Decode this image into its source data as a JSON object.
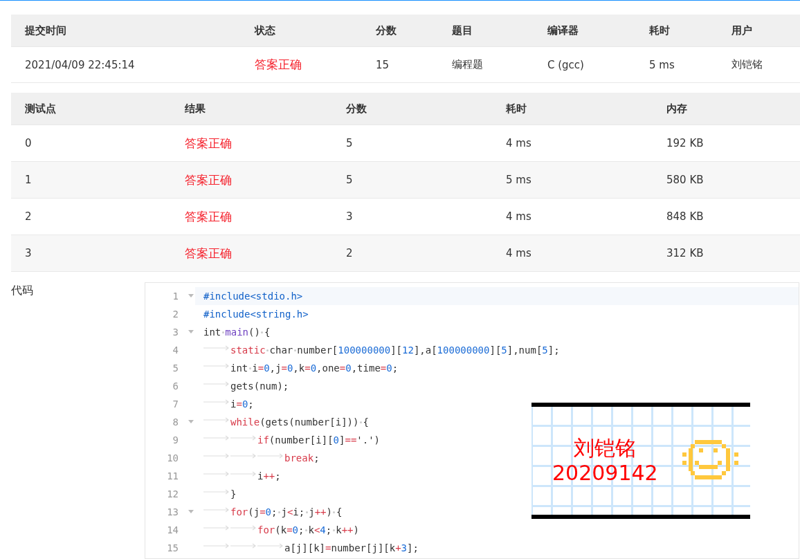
{
  "submission": {
    "columns": [
      "提交时间",
      "状态",
      "分数",
      "题目",
      "编译器",
      "耗时",
      "用户"
    ],
    "row": [
      {
        "kind": "plain",
        "text": "2021/04/09 22:45:14"
      },
      {
        "kind": "accepted",
        "text": "答案正确"
      },
      {
        "kind": "plain",
        "text": "15"
      },
      {
        "kind": "plain",
        "text": "编程题"
      },
      {
        "kind": "plain",
        "text": "C (gcc)"
      },
      {
        "kind": "plain",
        "text": "5 ms"
      },
      {
        "kind": "plain",
        "text": "刘铠铭"
      }
    ]
  },
  "tests": {
    "columns": [
      "测试点",
      "结果",
      "分数",
      "耗时",
      "内存"
    ],
    "rows": [
      [
        {
          "kind": "plain",
          "text": "0"
        },
        {
          "kind": "accepted",
          "text": "答案正确"
        },
        {
          "kind": "plain",
          "text": "5"
        },
        {
          "kind": "plain",
          "text": "4 ms"
        },
        {
          "kind": "plain",
          "text": "192 KB"
        }
      ],
      [
        {
          "kind": "plain",
          "text": "1"
        },
        {
          "kind": "accepted",
          "text": "答案正确"
        },
        {
          "kind": "plain",
          "text": "5"
        },
        {
          "kind": "plain",
          "text": "5 ms"
        },
        {
          "kind": "plain",
          "text": "580 KB"
        }
      ],
      [
        {
          "kind": "plain",
          "text": "2"
        },
        {
          "kind": "accepted",
          "text": "答案正确"
        },
        {
          "kind": "plain",
          "text": "3"
        },
        {
          "kind": "plain",
          "text": "4 ms"
        },
        {
          "kind": "plain",
          "text": "848 KB"
        }
      ],
      [
        {
          "kind": "plain",
          "text": "3"
        },
        {
          "kind": "accepted",
          "text": "答案正确"
        },
        {
          "kind": "plain",
          "text": "2"
        },
        {
          "kind": "plain",
          "text": "4 ms"
        },
        {
          "kind": "plain",
          "text": "312 KB"
        }
      ]
    ]
  },
  "code": {
    "label": "代码",
    "lines": [
      {
        "number": "1",
        "foldable": true,
        "current": true,
        "tokens": [
          {
            "kind": "pre",
            "text": "#include<stdio.h>"
          }
        ]
      },
      {
        "number": "2",
        "foldable": false,
        "current": false,
        "tokens": [
          {
            "kind": "pre",
            "text": "#include<string.h>"
          }
        ]
      },
      {
        "number": "3",
        "foldable": true,
        "current": false,
        "tokens": [
          {
            "kind": "plain",
            "text": "int"
          },
          {
            "kind": "space"
          },
          {
            "kind": "fn",
            "text": "main"
          },
          {
            "kind": "plain",
            "text": "()"
          },
          {
            "kind": "space"
          },
          {
            "kind": "plain",
            "text": "{"
          }
        ]
      },
      {
        "number": "4",
        "foldable": false,
        "current": false,
        "tokens": [
          {
            "kind": "tab"
          },
          {
            "kind": "kw",
            "text": "static"
          },
          {
            "kind": "space"
          },
          {
            "kind": "plain",
            "text": "char"
          },
          {
            "kind": "space"
          },
          {
            "kind": "plain",
            "text": "number["
          },
          {
            "kind": "num",
            "text": "100000000"
          },
          {
            "kind": "plain",
            "text": "]["
          },
          {
            "kind": "num",
            "text": "12"
          },
          {
            "kind": "plain",
            "text": "],a["
          },
          {
            "kind": "num",
            "text": "100000000"
          },
          {
            "kind": "plain",
            "text": "]["
          },
          {
            "kind": "num",
            "text": "5"
          },
          {
            "kind": "plain",
            "text": "],num["
          },
          {
            "kind": "num",
            "text": "5"
          },
          {
            "kind": "plain",
            "text": "];"
          }
        ]
      },
      {
        "number": "5",
        "foldable": false,
        "current": false,
        "tokens": [
          {
            "kind": "tab"
          },
          {
            "kind": "plain",
            "text": "int"
          },
          {
            "kind": "space"
          },
          {
            "kind": "plain",
            "text": "i"
          },
          {
            "kind": "op",
            "text": "="
          },
          {
            "kind": "num",
            "text": "0"
          },
          {
            "kind": "plain",
            "text": ",j"
          },
          {
            "kind": "op",
            "text": "="
          },
          {
            "kind": "num",
            "text": "0"
          },
          {
            "kind": "plain",
            "text": ",k"
          },
          {
            "kind": "op",
            "text": "="
          },
          {
            "kind": "num",
            "text": "0"
          },
          {
            "kind": "plain",
            "text": ",one"
          },
          {
            "kind": "op",
            "text": "="
          },
          {
            "kind": "num",
            "text": "0"
          },
          {
            "kind": "plain",
            "text": ",time"
          },
          {
            "kind": "op",
            "text": "="
          },
          {
            "kind": "num",
            "text": "0"
          },
          {
            "kind": "plain",
            "text": ";"
          }
        ]
      },
      {
        "number": "6",
        "foldable": false,
        "current": false,
        "tokens": [
          {
            "kind": "tab"
          },
          {
            "kind": "plain",
            "text": "gets(num);"
          }
        ]
      },
      {
        "number": "7",
        "foldable": false,
        "current": false,
        "tokens": [
          {
            "kind": "tab"
          },
          {
            "kind": "plain",
            "text": "i"
          },
          {
            "kind": "op",
            "text": "="
          },
          {
            "kind": "num",
            "text": "0"
          },
          {
            "kind": "plain",
            "text": ";"
          }
        ]
      },
      {
        "number": "8",
        "foldable": true,
        "current": false,
        "tokens": [
          {
            "kind": "tab"
          },
          {
            "kind": "kw",
            "text": "while"
          },
          {
            "kind": "plain",
            "text": "(gets(number[i]))"
          },
          {
            "kind": "space"
          },
          {
            "kind": "plain",
            "text": "{"
          }
        ]
      },
      {
        "number": "9",
        "foldable": false,
        "current": false,
        "tokens": [
          {
            "kind": "tab"
          },
          {
            "kind": "tab"
          },
          {
            "kind": "kw",
            "text": "if"
          },
          {
            "kind": "plain",
            "text": "(number[i]["
          },
          {
            "kind": "num",
            "text": "0"
          },
          {
            "kind": "plain",
            "text": "]"
          },
          {
            "kind": "op",
            "text": "=="
          },
          {
            "kind": "plain",
            "text": "'.')"
          }
        ]
      },
      {
        "number": "10",
        "foldable": false,
        "current": false,
        "tokens": [
          {
            "kind": "tab"
          },
          {
            "kind": "tab"
          },
          {
            "kind": "tab"
          },
          {
            "kind": "kw",
            "text": "break"
          },
          {
            "kind": "plain",
            "text": ";"
          }
        ]
      },
      {
        "number": "11",
        "foldable": false,
        "current": false,
        "tokens": [
          {
            "kind": "tab"
          },
          {
            "kind": "tab"
          },
          {
            "kind": "plain",
            "text": "i"
          },
          {
            "kind": "op",
            "text": "++"
          },
          {
            "kind": "plain",
            "text": ";"
          }
        ]
      },
      {
        "number": "12",
        "foldable": false,
        "current": false,
        "tokens": [
          {
            "kind": "tab"
          },
          {
            "kind": "plain",
            "text": "}"
          }
        ]
      },
      {
        "number": "13",
        "foldable": true,
        "current": false,
        "tokens": [
          {
            "kind": "tab"
          },
          {
            "kind": "kw",
            "text": "for"
          },
          {
            "kind": "plain",
            "text": "(j"
          },
          {
            "kind": "op",
            "text": "="
          },
          {
            "kind": "num",
            "text": "0"
          },
          {
            "kind": "plain",
            "text": ";"
          },
          {
            "kind": "space"
          },
          {
            "kind": "plain",
            "text": "j"
          },
          {
            "kind": "op",
            "text": "<"
          },
          {
            "kind": "plain",
            "text": "i;"
          },
          {
            "kind": "space"
          },
          {
            "kind": "plain",
            "text": "j"
          },
          {
            "kind": "op",
            "text": "++"
          },
          {
            "kind": "plain",
            "text": ")"
          },
          {
            "kind": "space"
          },
          {
            "kind": "plain",
            "text": "{"
          }
        ]
      },
      {
        "number": "14",
        "foldable": false,
        "current": false,
        "tokens": [
          {
            "kind": "tab"
          },
          {
            "kind": "tab"
          },
          {
            "kind": "kw",
            "text": "for"
          },
          {
            "kind": "plain",
            "text": "(k"
          },
          {
            "kind": "op",
            "text": "="
          },
          {
            "kind": "num",
            "text": "0"
          },
          {
            "kind": "plain",
            "text": ";"
          },
          {
            "kind": "space"
          },
          {
            "kind": "plain",
            "text": "k"
          },
          {
            "kind": "op",
            "text": "<"
          },
          {
            "kind": "num",
            "text": "4"
          },
          {
            "kind": "plain",
            "text": ";"
          },
          {
            "kind": "space"
          },
          {
            "kind": "plain",
            "text": "k"
          },
          {
            "kind": "op",
            "text": "++"
          },
          {
            "kind": "plain",
            "text": ")"
          }
        ]
      },
      {
        "number": "15",
        "foldable": false,
        "current": false,
        "tokens": [
          {
            "kind": "tab"
          },
          {
            "kind": "tab"
          },
          {
            "kind": "tab"
          },
          {
            "kind": "plain",
            "text": "a[j][k]"
          },
          {
            "kind": "op",
            "text": "="
          },
          {
            "kind": "plain",
            "text": "number[j][k"
          },
          {
            "kind": "op",
            "text": "+"
          },
          {
            "kind": "num",
            "text": "3"
          },
          {
            "kind": "plain",
            "text": "];"
          }
        ]
      }
    ]
  },
  "sticker": {
    "name": "刘铠铭",
    "id": "20209142"
  }
}
